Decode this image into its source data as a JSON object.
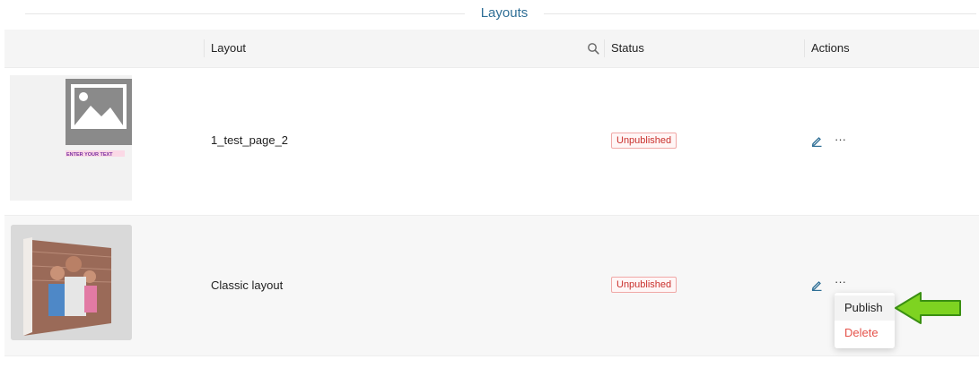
{
  "section": {
    "title": "Layouts"
  },
  "table": {
    "columns": {
      "layout": "Layout",
      "status": "Status",
      "actions": "Actions"
    }
  },
  "rows": [
    {
      "layout_name": "1_test_page_2",
      "status": "Unpublished",
      "thumbnail_caption": "ENTER YOUR TEXT"
    },
    {
      "layout_name": "Classic layout",
      "status": "Unpublished"
    }
  ],
  "actions": {
    "more": "···"
  },
  "dropdown": {
    "publish": "Publish",
    "delete": "Delete"
  },
  "colors": {
    "accent": "#2f6f96",
    "danger": "#c9302c",
    "pointer_arrow": "#7ed321"
  }
}
